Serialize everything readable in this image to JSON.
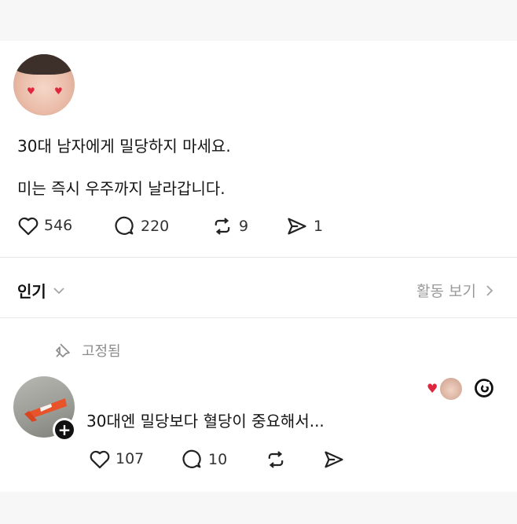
{
  "post": {
    "line1": "30대 남자에게 밀당하지 마세요.",
    "line2": "미는 즉시 우주까지 날라갑니다.",
    "likes": "546",
    "comments": "220",
    "reposts": "9",
    "shares": "1"
  },
  "sort": {
    "label": "인기",
    "activity": "활동 보기"
  },
  "pinned": {
    "label": "고정됨"
  },
  "reply": {
    "text": "30대엔 밀당보다 혈당이 중요해서...",
    "likes": "107",
    "comments": "10"
  },
  "icons": {
    "like": "heart-outline-icon",
    "comment": "speech-bubble-icon",
    "repost": "repost-icon",
    "share": "send-icon",
    "pin": "pin-icon",
    "chevron_down": "chevron-down-icon",
    "chevron_right": "chevron-right-icon",
    "threads": "threads-logo",
    "plus": "plus-icon"
  },
  "colors": {
    "accent_heart": "#e0263c",
    "muted_text": "#9a9a9a",
    "text": "#141414"
  }
}
